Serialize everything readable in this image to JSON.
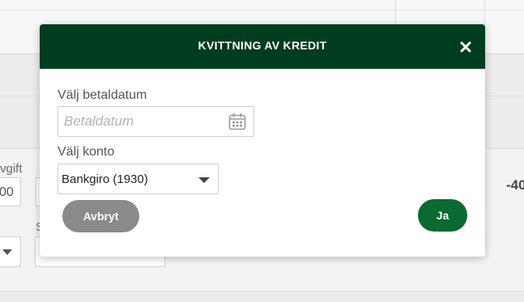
{
  "background": {
    "label_fee_partial": "vgift",
    "amount_partial": "00",
    "amount_right_partial": "-40",
    "label_s_partial": "S"
  },
  "modal": {
    "title": "KVITTNING AV KREDIT",
    "close_label": "×",
    "date_label": "Välj betaldatum",
    "date_placeholder": "Betaldatum",
    "date_value": "",
    "account_label": "Välj konto",
    "account_selected": "Bankgiro (1930)",
    "cancel_label": "Avbryt",
    "confirm_label": "Ja"
  },
  "colors": {
    "header_bg": "#003d1e",
    "confirm_bg": "#0a6a2f",
    "cancel_bg": "#8a8a8a"
  },
  "icons": {
    "close": "close-icon",
    "calendar": "calendar-icon",
    "select_caret": "chevron-down-icon"
  }
}
